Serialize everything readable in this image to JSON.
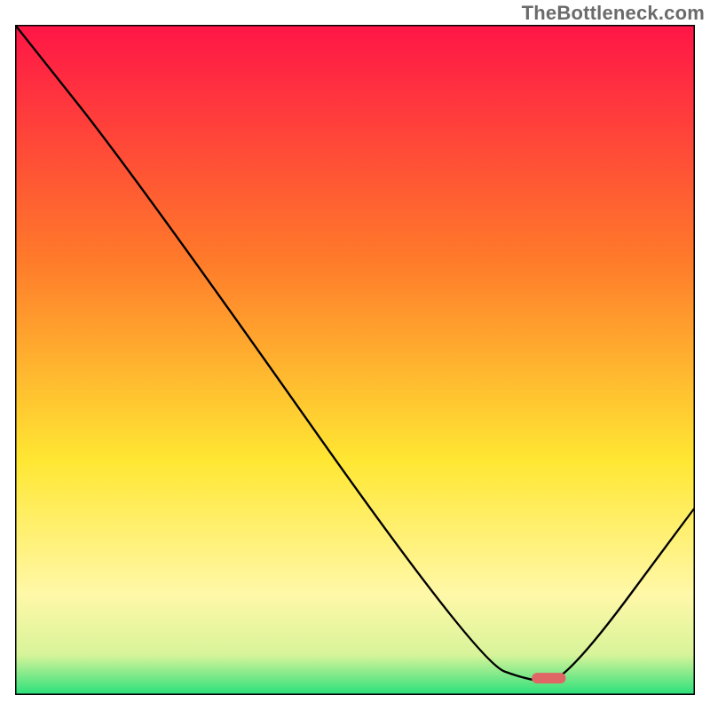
{
  "watermark": "TheBottleneck.com",
  "chart_data": {
    "type": "line",
    "title": "",
    "xlabel": "",
    "ylabel": "",
    "xlim": [
      0,
      100
    ],
    "ylim": [
      0,
      100
    ],
    "grid": false,
    "legend": false,
    "gradient_stops": [
      {
        "offset": 0,
        "color": "#ff1547"
      },
      {
        "offset": 35,
        "color": "#ff7a2a"
      },
      {
        "offset": 65,
        "color": "#ffe733"
      },
      {
        "offset": 85,
        "color": "#fff8a8"
      },
      {
        "offset": 94,
        "color": "#d8f49a"
      },
      {
        "offset": 100,
        "color": "#29e07a"
      }
    ],
    "series": [
      {
        "name": "bottleneck-curve",
        "color": "#000000",
        "x": [
          0,
          18,
          68,
          76,
          81,
          100
        ],
        "y": [
          100,
          77,
          5,
          2,
          2,
          28
        ]
      }
    ],
    "highlight_segment": {
      "name": "optimal-range",
      "color": "#e06666",
      "x_start": 76,
      "x_end": 81,
      "y": 2.5,
      "thickness_pct": 1.6
    }
  }
}
